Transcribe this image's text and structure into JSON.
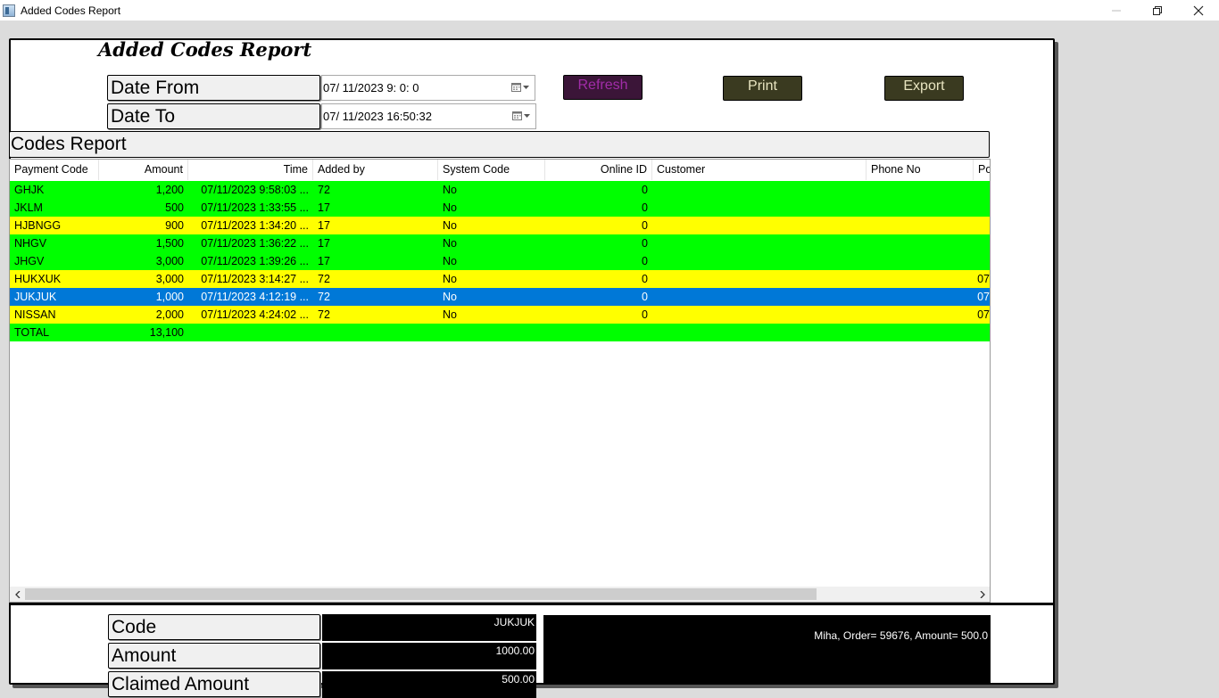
{
  "window": {
    "title": "Added Codes Report"
  },
  "report": {
    "title": "Added Codes Report",
    "date_from_label": "Date From",
    "date_from_value": "07/ 11/2023   9:  0:  0",
    "date_to_label": "Date To",
    "date_to_value": "07/ 11/2023  16:50:32",
    "refresh_label": "Refresh",
    "print_label": "Print",
    "export_label": "Export",
    "section_title": "Codes Report"
  },
  "colors": {
    "row_green": "#00ff00",
    "row_yellow": "#ffff00",
    "row_selected": "#0078d7"
  },
  "table": {
    "columns": [
      "Payment Code",
      "Amount",
      "Time",
      "Added by",
      "System Code",
      "Online ID",
      "Customer",
      "Phone No",
      "Po"
    ],
    "rows": [
      {
        "code": "GHJK",
        "amount": "1,200",
        "time": "07/11/2023 9:58:03 ...",
        "added_by": "72",
        "system_code": "No",
        "online_id": "0",
        "customer": "",
        "phone": "",
        "po": "",
        "color": "green"
      },
      {
        "code": "JKLM",
        "amount": "500",
        "time": "07/11/2023 1:33:55 ...",
        "added_by": "17",
        "system_code": "No",
        "online_id": "0",
        "customer": "",
        "phone": "",
        "po": "",
        "color": "green"
      },
      {
        "code": "HJBNGG",
        "amount": "900",
        "time": "07/11/2023 1:34:20 ...",
        "added_by": "17",
        "system_code": "No",
        "online_id": "0",
        "customer": "",
        "phone": "",
        "po": "",
        "color": "yellow"
      },
      {
        "code": "NHGV",
        "amount": "1,500",
        "time": "07/11/2023 1:36:22 ...",
        "added_by": "17",
        "system_code": "No",
        "online_id": "0",
        "customer": "",
        "phone": "",
        "po": "",
        "color": "green"
      },
      {
        "code": "JHGV",
        "amount": "3,000",
        "time": "07/11/2023 1:39:26 ...",
        "added_by": "17",
        "system_code": "No",
        "online_id": "0",
        "customer": "",
        "phone": "",
        "po": "",
        "color": "green"
      },
      {
        "code": "HUKXUK",
        "amount": "3,000",
        "time": "07/11/2023 3:14:27 ...",
        "added_by": "72",
        "system_code": "No",
        "online_id": "0",
        "customer": "",
        "phone": "",
        "po": "07",
        "color": "yellow"
      },
      {
        "code": "JUKJUK",
        "amount": "1,000",
        "time": "07/11/2023 4:12:19 ...",
        "added_by": "72",
        "system_code": "No",
        "online_id": "0",
        "customer": "",
        "phone": "",
        "po": "07",
        "color": "selected"
      },
      {
        "code": "NISSAN",
        "amount": "2,000",
        "time": "07/11/2023 4:24:02 ...",
        "added_by": "72",
        "system_code": "No",
        "online_id": "0",
        "customer": "",
        "phone": "",
        "po": "07",
        "color": "yellow"
      },
      {
        "code": "TOTAL",
        "amount": "13,100",
        "time": "",
        "added_by": "",
        "system_code": "",
        "online_id": "",
        "customer": "",
        "phone": "",
        "po": "",
        "color": "green"
      }
    ]
  },
  "details": {
    "code_label": "Code",
    "code_value": "JUKJUK",
    "amount_label": "Amount",
    "amount_value": "1000.00",
    "claimed_label": "Claimed Amount",
    "claimed_value": "500.00",
    "info_text": "Miha, Order= 59676, Amount= 500.0"
  }
}
